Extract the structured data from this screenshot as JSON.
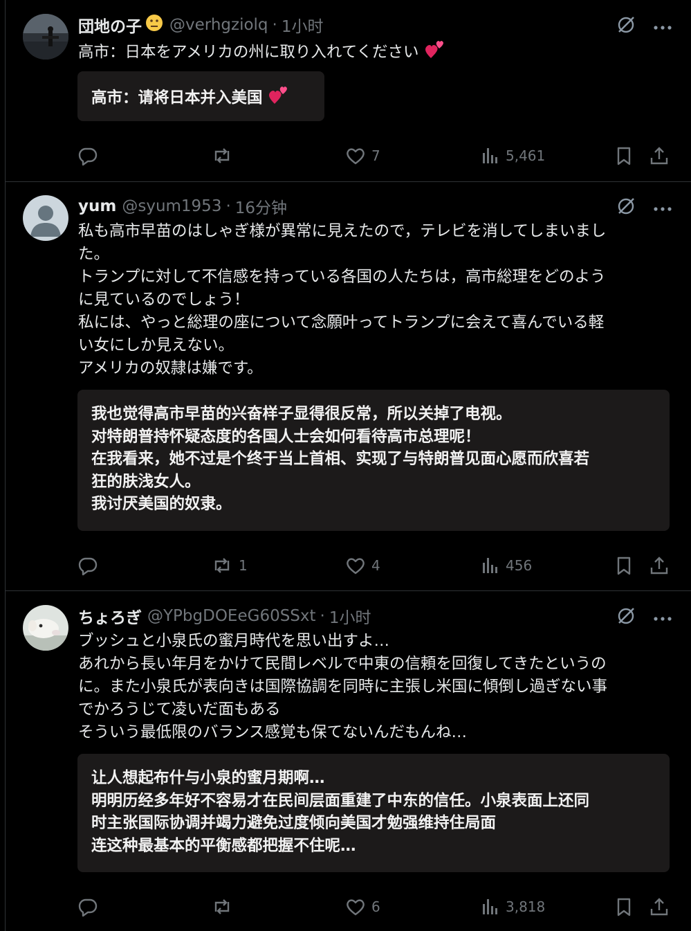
{
  "posts": [
    {
      "name": "団地の子",
      "handle": "@verhgziolq",
      "time": "1小时",
      "body": [
        "高市：日本をアメリカの州に取り入れてください"
      ],
      "translation": [
        "高市：请将日本并入美国"
      ],
      "stats": {
        "replies": "",
        "reposts": "",
        "likes": "7",
        "views": "5,461"
      }
    },
    {
      "name": "yum",
      "handle": "@syum1953",
      "time": "16分钟",
      "body": [
        "私も高市早苗のはしゃぎ様が異常に見えたので，テレビを消してしまいまし",
        "た。",
        "トランプに対して不信感を持っている各国の人たちは，高市総理をどのよう",
        "に見ているのでしょう！",
        "私には、やっと総理の座について念願叶ってトランプに会えて喜んでいる軽",
        "い女にしか見えない。",
        "アメリカの奴隷は嫌です。"
      ],
      "translation": [
        "我也觉得高市早苗的兴奋样子显得很反常，所以关掉了电视。",
        "对特朗普持怀疑态度的各国人士会如何看待高市总理呢！",
        "在我看来，她不过是个终于当上首相、实现了与特朗普见面心愿而欣喜若",
        "狂的肤浅女人。",
        "我讨厌美国的奴隶。"
      ],
      "stats": {
        "replies": "",
        "reposts": "1",
        "likes": "4",
        "views": "456"
      }
    },
    {
      "name": "ちょろぎ",
      "handle": "@YPbgDOEeG60SSxt",
      "time": "1小时",
      "body": [
        "ブッシュと小泉氏の蜜月時代を思い出すよ…",
        "あれから長い年月をかけて民間レベルで中東の信頼を回復してきたというの",
        "に。また小泉氏が表向きは国際協調を同時に主張し米国に傾倒し過ぎない事",
        "でかろうじて凌いだ面もある",
        "そういう最低限のバランス感覚も保てないんだもんね…"
      ],
      "translation": [
        "让人想起布什与小泉的蜜月期啊…",
        "明明历经多年好不容易才在民间层面重建了中东的信任。小泉表面上还同",
        "时主张国际协调并竭力避免过度倾向美国才勉强维持住局面",
        "连这种最基本的平衡感都把握不住呢…"
      ],
      "stats": {
        "replies": "",
        "reposts": "",
        "likes": "6",
        "views": "3,818"
      }
    }
  ],
  "icons": {
    "name_emoji": "neutral-face-icon",
    "heart_emoji": "two-hearts-icon",
    "grok": "grok-icon",
    "more": "more-icon",
    "reply": "reply-icon",
    "repost": "repost-icon",
    "like": "like-icon",
    "views": "views-icon",
    "bookmark": "bookmark-icon",
    "share": "share-icon"
  },
  "colors": {
    "background": "#000000",
    "text": "#e7e9ea",
    "muted": "#71767b",
    "translation_bg": "#1c1a1a",
    "separator": "#2f3336"
  }
}
